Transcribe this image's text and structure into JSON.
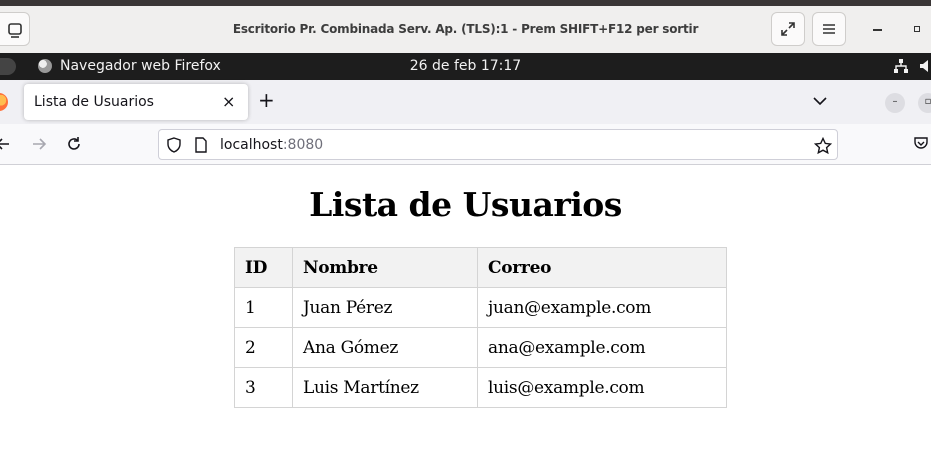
{
  "remote_window": {
    "title": "Escritorio Pr. Combinada Serv. Ap. (TLS):1 - Prem SHIFT+F12 per sortir"
  },
  "gnome_panel": {
    "app_name": "Navegador web Firefox",
    "clock": "26 de feb  17:17"
  },
  "browser": {
    "tab": {
      "label": "Lista de Usuarios"
    },
    "url": {
      "host": "localhost",
      "port": ":8080"
    }
  },
  "page": {
    "title": "Lista de Usuarios",
    "table": {
      "headers": [
        "ID",
        "Nombre",
        "Correo"
      ],
      "rows": [
        [
          "1",
          "Juan Pérez",
          "juan@example.com"
        ],
        [
          "2",
          "Ana Gómez",
          "ana@example.com"
        ],
        [
          "3",
          "Luis Martínez",
          "luis@example.com"
        ]
      ]
    }
  },
  "icons": {
    "rd_menu": "window-icon",
    "rd_fullscreen": "expand-icon",
    "rd_hamburger": "menu-icon",
    "browser_back": "arrow-left-icon",
    "browser_forward": "arrow-right-icon",
    "browser_reload": "reload-icon",
    "site_info": "shield-icon",
    "page_info": "page-icon",
    "bookmark": "star-icon",
    "pocket": "pocket-icon"
  }
}
